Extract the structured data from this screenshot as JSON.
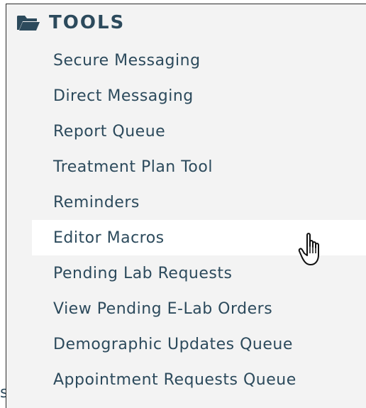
{
  "section": {
    "title": "TOOLS",
    "icon": "folder-open-icon",
    "color": "#2c4a5c"
  },
  "menu": {
    "items": [
      {
        "label": "Secure Messaging"
      },
      {
        "label": "Direct Messaging"
      },
      {
        "label": "Report Queue"
      },
      {
        "label": "Treatment Plan Tool"
      },
      {
        "label": "Reminders"
      },
      {
        "label": "Editor Macros",
        "hovered": true
      },
      {
        "label": "Pending Lab Requests"
      },
      {
        "label": "View Pending E-Lab Orders"
      },
      {
        "label": "Demographic Updates Queue"
      },
      {
        "label": "Appointment Requests Queue"
      }
    ]
  },
  "cursor": {
    "icon": "hand-pointer-icon"
  },
  "corner_text": "s"
}
